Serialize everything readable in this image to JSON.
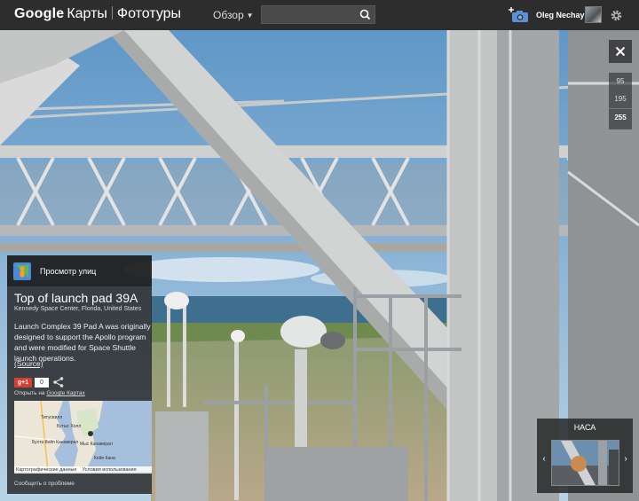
{
  "header": {
    "brand_google": "Google",
    "brand_maps": "Карты",
    "brand_photos": "Фототуры",
    "overview_label": "Обзор",
    "search_placeholder": "",
    "user_name": "Oleg Nechay"
  },
  "viewer": {
    "close_symbol": "✕",
    "zoom_levels": [
      "95",
      "195",
      "255"
    ],
    "active_zoom": "255"
  },
  "info_panel": {
    "header_label": "Просмотр улиц",
    "title": "Top of launch pad 39A",
    "subtitle": "Kennedy Space Center, Florida, United States",
    "description": "Launch Complex 39 Pad A was originally designed to support the Apollo program and were modified for Space Shuttle launch operations.",
    "source_link": "(Source)",
    "gplus_label": "g+1",
    "gplus_count": "0",
    "open_prefix": "Открыть на ",
    "open_link": "Google Картах",
    "minimap": {
      "labels": [
        "Титусвилл",
        "Бутыс Холл",
        "Бухта Кейп Канаверал",
        "Мыс Канаверал",
        "Кейп Кана"
      ]
    },
    "map_footer_data": "Картографические данные",
    "map_footer_terms": "Условия использования",
    "report_problem": "Сообщить о проблеме"
  },
  "gallery": {
    "title": "НАСА",
    "prev_symbol": "‹",
    "next_symbol": "›"
  },
  "colors": {
    "topbar": "#2d2d2d",
    "sky": "#7fb0d8",
    "steel": "#cfd1d0",
    "gplus": "#d73d32"
  },
  "icons": [
    "search-icon",
    "camera-plus-icon",
    "gear-icon",
    "close-icon",
    "pegman-icon",
    "share-icon",
    "chevron-left-icon",
    "chevron-right-icon"
  ]
}
